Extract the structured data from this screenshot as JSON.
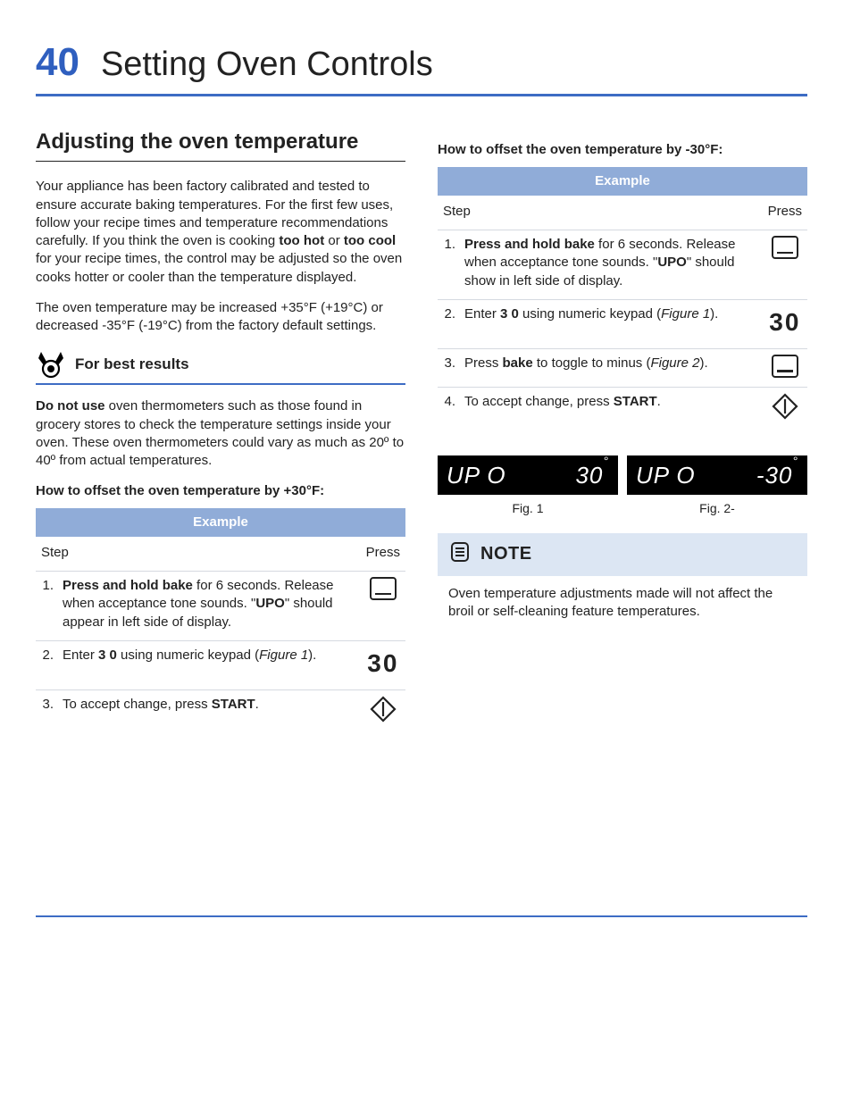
{
  "page_number": "40",
  "page_title": "Setting Oven Controls",
  "section_heading": "Adjusting the oven temperature",
  "intro_p1a": "Your appliance has been factory calibrated and tested to ensure accurate baking temperatures. For the first few uses, follow your recipe times and temperature recommendations carefully. If you think the oven is cooking ",
  "intro_p1b": "too hot",
  "intro_p1c": " or ",
  "intro_p1d": "too cool",
  "intro_p1e": " for your recipe times, the control may be adjusted so the oven cooks hotter or cooler than the temperature displayed.",
  "intro_p2": "The oven temperature may be increased +35°F (+19°C) or decreased -35°F (-19°C) from the factory default settings.",
  "tip_heading": "For best results",
  "tip_p1a": "Do not use",
  "tip_p1b": " oven thermometers such as those found in grocery stores to check the temperature settings inside your oven. These oven thermometers could vary as much as 20º to 40º from actual temperatures.",
  "howto_plus_heading": "How to offset the oven temperature by +30°F:",
  "howto_minus_heading": "How to offset the oven temperature by -30°F:",
  "table_header": "Example",
  "col_step": "Step",
  "col_press": "Press",
  "plus_steps": [
    {
      "n": "1.",
      "pre": "Press and hold bake",
      "post": " for 6 seconds. Release when acceptance tone sounds. \"",
      "mid": "UPO",
      "tail": "\" should appear in left side of display.",
      "icon": "square",
      "val": ""
    },
    {
      "n": "2.",
      "pre": "Enter ",
      "post": "",
      "mid": "3 0",
      "tail": " using numeric keypad (",
      "fig": "Figure 1",
      "close": ").",
      "icon": "num",
      "val": "30"
    },
    {
      "n": "3.",
      "pre": "To accept change, press ",
      "post": "",
      "mid": "START",
      "tail": ".",
      "icon": "diamond",
      "val": ""
    }
  ],
  "minus_steps": [
    {
      "n": "1.",
      "pre": "Press and hold bake",
      "post": " for 6 seconds. Release when acceptance tone sounds. \"",
      "mid": "UPO",
      "tail": "\" should show in left side of display.",
      "icon": "square",
      "val": ""
    },
    {
      "n": "2.",
      "pre": "Enter ",
      "post": "",
      "mid": "3 0",
      "tail": " using numeric keypad (",
      "fig": "Figure 1",
      "close": ").",
      "icon": "num",
      "val": "30"
    },
    {
      "n": "3.",
      "pre": "Press ",
      "post": "",
      "mid": "bake",
      "tail": " to toggle to minus (",
      "fig": "Figure 2",
      "close": ").",
      "icon": "square",
      "val": ""
    },
    {
      "n": "4.",
      "pre": "To accept change, press ",
      "post": "",
      "mid": "START",
      "tail": ".",
      "icon": "diamond",
      "val": ""
    }
  ],
  "seg1_left": "UP O",
  "seg1_right": "30",
  "seg2_left": "UP O",
  "seg2_right": "-30",
  "fig1_cap": "Fig. 1",
  "fig2_cap": "Fig. 2-",
  "note_label": "NOTE",
  "note_body": "Oven temperature adjustments made will not affect the broil or self-cleaning feature temperatures."
}
